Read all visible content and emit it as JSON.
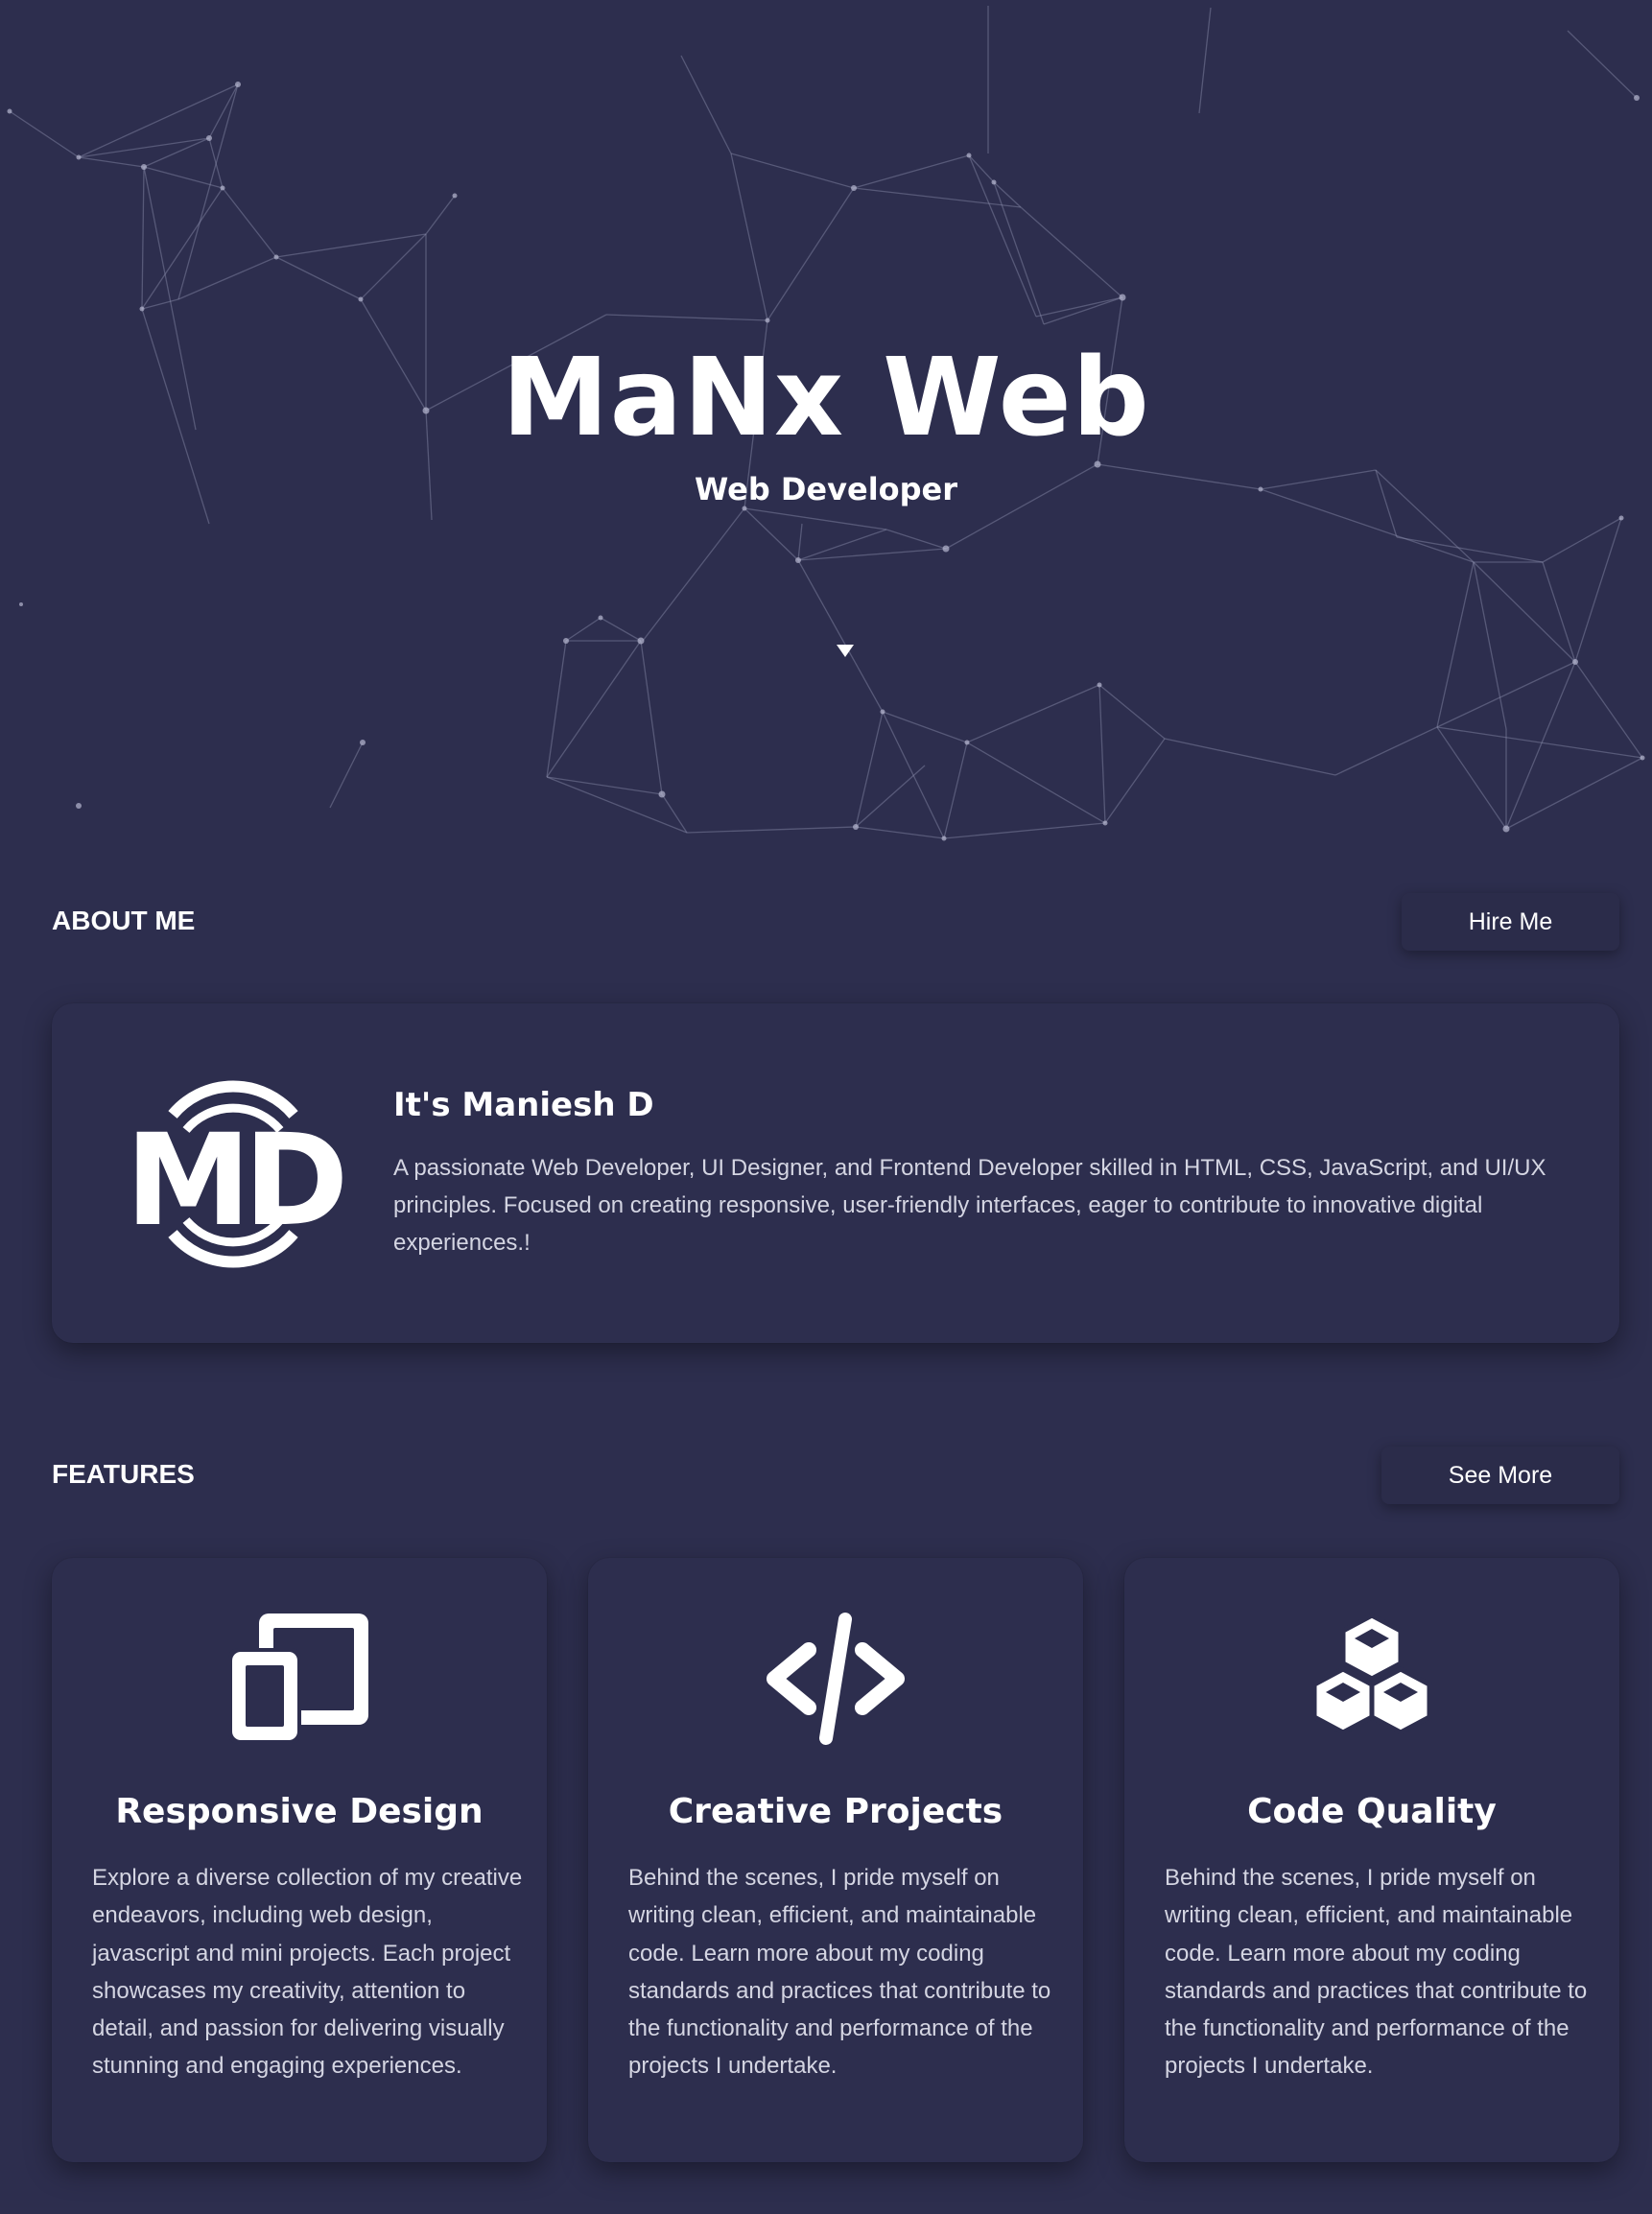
{
  "hero": {
    "title": "MaNx Web",
    "subtitle": "Web Developer"
  },
  "about": {
    "heading": "ABOUT ME",
    "button_label": "Hire Me",
    "logo_text": "MD",
    "name": "It's Maniesh D",
    "description": "A passionate Web Developer, UI Designer, and Frontend Developer skilled in HTML, CSS, JavaScript, and UI/UX principles. Focused on creating responsive, user-friendly interfaces, eager to contribute to innovative digital experiences.!"
  },
  "features": {
    "heading": "FEATURES",
    "button_label": "See More",
    "items": [
      {
        "icon": "responsive-devices-icon",
        "title": "Responsive Design",
        "text": "Explore a diverse collection of my creative endeavors, including web design, javascript and mini projects. Each project showcases my creativity, attention to detail, and passion for delivering visually stunning and engaging experiences."
      },
      {
        "icon": "code-icon",
        "title": "Creative Projects",
        "text": "Behind the scenes, I pride myself on writing clean, efficient, and maintainable code. Learn more about my coding standards and practices that contribute to the functionality and performance of the projects I undertake."
      },
      {
        "icon": "cubes-icon",
        "title": "Code Quality",
        "text": "Behind the scenes, I pride myself on writing clean, efficient, and maintainable code. Learn more about my coding standards and practices that contribute to the functionality and performance of the projects I undertake."
      }
    ]
  },
  "colors": {
    "background": "#2d2e4e",
    "text": "#ffffff",
    "muted_text": "#d4d5e2",
    "button_bg": "#2b2c4a"
  }
}
